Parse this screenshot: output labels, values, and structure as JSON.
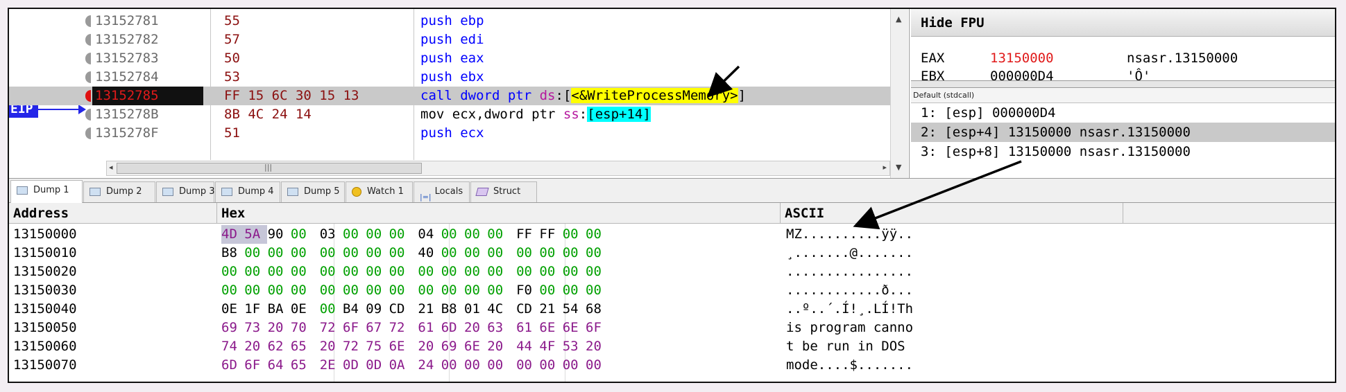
{
  "disasm": {
    "eip_label": "EIP",
    "rows": [
      {
        "addr": "13152781",
        "bytes": "55",
        "instr": [
          {
            "t": "push ebp",
            "c": "kw"
          }
        ]
      },
      {
        "addr": "13152782",
        "bytes": "57",
        "instr": [
          {
            "t": "push edi",
            "c": "kw"
          }
        ]
      },
      {
        "addr": "13152783",
        "bytes": "50",
        "instr": [
          {
            "t": "push eax",
            "c": "kw"
          }
        ]
      },
      {
        "addr": "13152784",
        "bytes": "53",
        "instr": [
          {
            "t": "push ebx",
            "c": "kw"
          }
        ]
      },
      {
        "addr": "13152785",
        "bytes": "FF 15 6C 30 15 13",
        "instr": [
          {
            "t": "call",
            "c": "kw"
          },
          {
            "t": " dword ptr ",
            "c": "kw"
          },
          {
            "t": "ds",
            "c": "seg"
          },
          {
            "t": ":[",
            "c": "brk"
          },
          {
            "t": "<&WriteProcessMemory>",
            "c": "api"
          },
          {
            "t": "]",
            "c": "brk"
          }
        ]
      },
      {
        "addr": "1315278B",
        "bytes": "8B 4C 24 14",
        "instr": [
          {
            "t": "mov ecx,dword ptr ",
            "c": "op"
          },
          {
            "t": "ss",
            "c": "seg"
          },
          {
            "t": ":",
            "c": "op"
          },
          {
            "t": "[esp+14]",
            "c": "esp"
          }
        ]
      },
      {
        "addr": "1315278F",
        "bytes": "51",
        "instr": [
          {
            "t": "push ecx",
            "c": "kw"
          }
        ]
      }
    ]
  },
  "registers": {
    "header": "Hide FPU",
    "rows": [
      {
        "name": "EAX",
        "value": "13150000",
        "comment": "nsasr.13150000",
        "changed": true
      },
      {
        "name": "EBX",
        "value": "000000D4",
        "comment": "'Ô'",
        "changed": false
      }
    ]
  },
  "stack": {
    "convention": "Default (stdcall)",
    "rows": [
      "1: [esp] 000000D4",
      "2: [esp+4] 13150000 nsasr.13150000",
      "3: [esp+8] 13150000 nsasr.13150000"
    ],
    "selected_index": 1
  },
  "tabs": [
    {
      "label": "Dump 1",
      "icon": "dump-icon",
      "active": true
    },
    {
      "label": "Dump 2",
      "icon": "dump-icon"
    },
    {
      "label": "Dump 3",
      "icon": "dump-icon"
    },
    {
      "label": "Dump 4",
      "icon": "dump-icon"
    },
    {
      "label": "Dump 5",
      "icon": "dump-icon"
    },
    {
      "label": "Watch 1",
      "icon": "watch-icon"
    },
    {
      "label": "Locals",
      "icon": "locals-icon"
    },
    {
      "label": "Struct",
      "icon": "struct-icon"
    }
  ],
  "dump": {
    "headers": {
      "address": "Address",
      "hex": "Hex",
      "ascii": "ASCII"
    },
    "rows": [
      {
        "addr": "13150000",
        "hex": [
          "4D",
          "5A",
          "90",
          "00",
          "03",
          "00",
          "00",
          "00",
          "04",
          "00",
          "00",
          "00",
          "FF",
          "FF",
          "00",
          "00"
        ],
        "ascii": "MZ..........ÿÿ.."
      },
      {
        "addr": "13150010",
        "hex": [
          "B8",
          "00",
          "00",
          "00",
          "00",
          "00",
          "00",
          "00",
          "40",
          "00",
          "00",
          "00",
          "00",
          "00",
          "00",
          "00"
        ],
        "ascii": "¸.......@......."
      },
      {
        "addr": "13150020",
        "hex": [
          "00",
          "00",
          "00",
          "00",
          "00",
          "00",
          "00",
          "00",
          "00",
          "00",
          "00",
          "00",
          "00",
          "00",
          "00",
          "00"
        ],
        "ascii": "................"
      },
      {
        "addr": "13150030",
        "hex": [
          "00",
          "00",
          "00",
          "00",
          "00",
          "00",
          "00",
          "00",
          "00",
          "00",
          "00",
          "00",
          "F0",
          "00",
          "00",
          "00"
        ],
        "ascii": "............ð..."
      },
      {
        "addr": "13150040",
        "hex": [
          "0E",
          "1F",
          "BA",
          "0E",
          "00",
          "B4",
          "09",
          "CD",
          "21",
          "B8",
          "01",
          "4C",
          "CD",
          "21",
          "54",
          "68"
        ],
        "ascii": "..º..´.Í!¸.LÍ!Th"
      },
      {
        "addr": "13150050",
        "hex": [
          "69",
          "73",
          "20",
          "70",
          "72",
          "6F",
          "67",
          "72",
          "61",
          "6D",
          "20",
          "63",
          "61",
          "6E",
          "6E",
          "6F"
        ],
        "ascii": "is program canno"
      },
      {
        "addr": "13150060",
        "hex": [
          "74",
          "20",
          "62",
          "65",
          "20",
          "72",
          "75",
          "6E",
          "20",
          "69",
          "6E",
          "20",
          "44",
          "4F",
          "53",
          "20"
        ],
        "ascii": "t be run in DOS "
      },
      {
        "addr": "13150070",
        "hex": [
          "6D",
          "6F",
          "64",
          "65",
          "2E",
          "0D",
          "0D",
          "0A",
          "24",
          "00",
          "00",
          "00",
          "00",
          "00",
          "00",
          "00"
        ],
        "ascii": "mode....$......."
      }
    ]
  }
}
